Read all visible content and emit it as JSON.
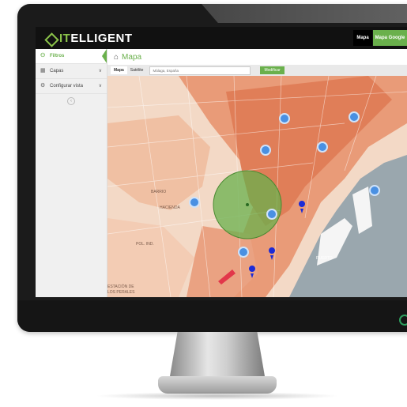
{
  "app": {
    "logo_text_prefix": "",
    "logo_text_highlight": "IT",
    "logo_text_rest": "ELLIGENT",
    "tabs": [
      {
        "label": "Mapa"
      },
      {
        "label": "Mapa Google"
      }
    ]
  },
  "sidebar": {
    "items": [
      {
        "label": "Filtros",
        "icon": "binoculars-icon",
        "active": true
      },
      {
        "label": "Capas",
        "icon": "calendar-icon",
        "chevron": "∨"
      },
      {
        "label": "Configurar vista",
        "icon": "gear-icon",
        "chevron": "∨"
      }
    ],
    "collapse": "‹"
  },
  "breadcrumb": {
    "home_icon": "⌂",
    "title": "Mapa"
  },
  "map_toolbar": {
    "map_type_active": "Mapa",
    "map_type_other": "Satélite",
    "search_placeholder": "Málaga, España",
    "button": "Modificar"
  },
  "map": {
    "labels": [
      {
        "text": "PUERTO"
      },
      {
        "text": "BARRIO"
      },
      {
        "text": "HACIENDA"
      },
      {
        "text": "POL. IND."
      },
      {
        "text": "ESTACIÓN DE"
      },
      {
        "text": "LOS PERALES"
      }
    ],
    "colors": {
      "heat": "#e8906a",
      "radius": "#6ab04c",
      "sea": "#9aa7ae",
      "marker": "#1c2bd6",
      "cluster": "#4a90e2"
    }
  }
}
